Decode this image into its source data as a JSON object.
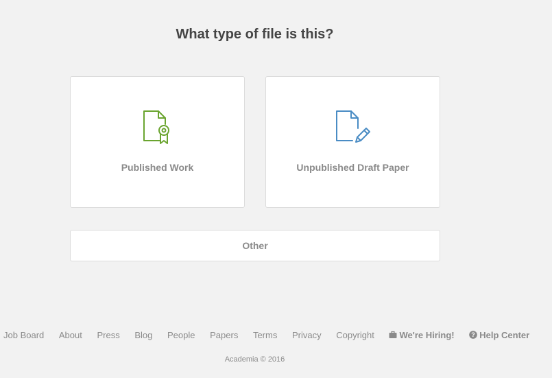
{
  "heading": "What type of file is this?",
  "options": {
    "published": {
      "label": "Published Work",
      "icon": "certified-document-icon",
      "color": "#6aa42f"
    },
    "unpublished": {
      "label": "Unpublished Draft Paper",
      "icon": "document-edit-icon",
      "color": "#4a8cc4"
    },
    "other": {
      "label": "Other"
    }
  },
  "footer": {
    "links": {
      "job_board": "Job Board",
      "about": "About",
      "press": "Press",
      "blog": "Blog",
      "people": "People",
      "papers": "Papers",
      "terms": "Terms",
      "privacy": "Privacy",
      "copyright": "Copyright",
      "hiring": "We're Hiring!",
      "help": "Help Center"
    },
    "copyright_text": "Academia © 2016"
  }
}
